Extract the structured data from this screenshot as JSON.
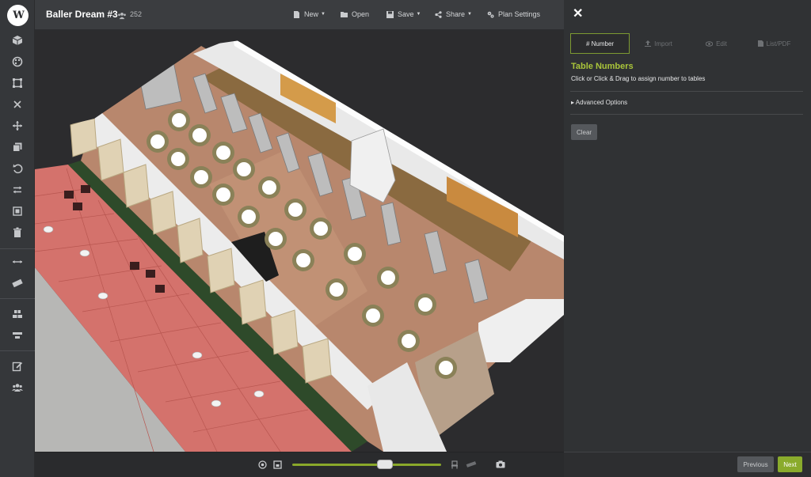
{
  "app": {
    "logo_text": "W"
  },
  "header": {
    "plan_title": "Baller Dream #3",
    "guest_count": "252",
    "menus": {
      "new": "New",
      "open": "Open",
      "save": "Save",
      "share": "Share",
      "plan_settings": "Plan Settings"
    }
  },
  "toolbar": {
    "tools": [
      "3d-cube",
      "palette",
      "select-box",
      "close",
      "move",
      "duplicate",
      "undo",
      "swap",
      "align-box",
      "delete",
      "measure",
      "ruler",
      "distribute-vertical",
      "distribute-horizontal",
      "edit-note",
      "guests"
    ]
  },
  "panel": {
    "tabs": [
      "# Number",
      "Import",
      "Edit",
      "List/PDF"
    ],
    "active_tab": "# Number",
    "heading": "Table Numbers",
    "description": "Click or Click & Drag to assign number to tables",
    "advanced_options": "▸ Advanced Options",
    "clear": "Clear",
    "previous": "Previous",
    "next": "Next"
  },
  "zoom": {
    "level_fraction": 0.62
  },
  "colors": {
    "accent_green": "#8aab2c",
    "heading_green": "#a9c43a",
    "floor_wood": "#8a6a40",
    "patio_tile": "#d4726c"
  }
}
